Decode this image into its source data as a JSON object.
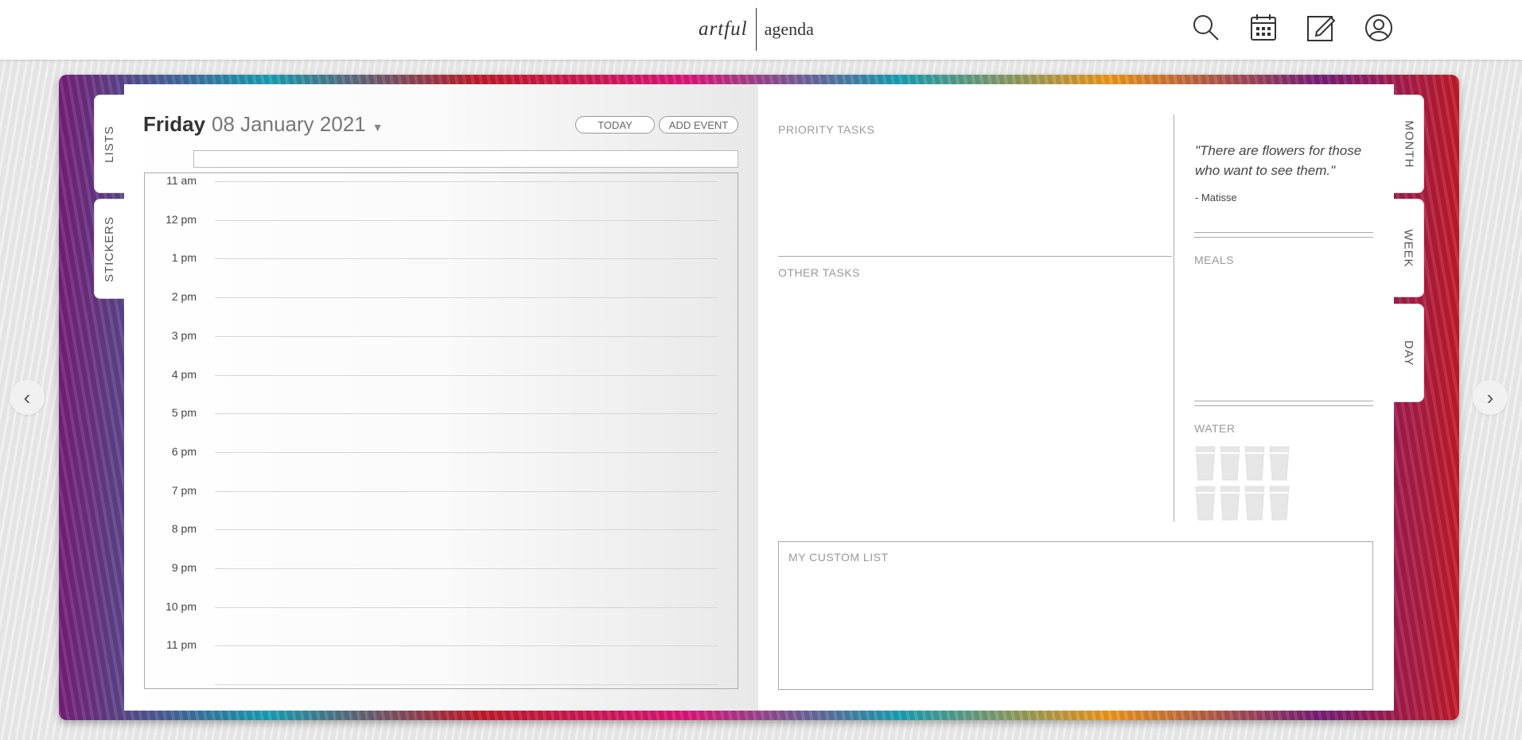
{
  "header": {
    "logo_part1": "artful",
    "logo_part2": "agenda",
    "icons": [
      "search-icon",
      "calendar-icon",
      "edit-icon",
      "user-icon"
    ]
  },
  "left_tabs": [
    "LISTS",
    "STICKERS"
  ],
  "right_tabs": [
    "MONTH",
    "WEEK",
    "DAY"
  ],
  "day": {
    "weekday": "Friday",
    "date": "08 January 2021",
    "today_label": "TODAY",
    "add_event_label": "ADD EVENT",
    "hours": [
      "11 am",
      "12 pm",
      "1 pm",
      "2 pm",
      "3 pm",
      "4 pm",
      "5 pm",
      "6 pm",
      "7 pm",
      "8 pm",
      "9 pm",
      "10 pm",
      "11 pm"
    ]
  },
  "right": {
    "priority_tasks": "PRIORITY TASKS",
    "other_tasks": "OTHER TASKS",
    "quote": "\"There are flowers for those who want to see them.\"",
    "quote_author": "- Matisse",
    "meals": "MEALS",
    "water": "WATER",
    "water_glasses": 8,
    "custom_list": "MY CUSTOM LIST"
  },
  "colors": {
    "text": "#333333",
    "muted": "#999999",
    "line": "#aaaaaa"
  }
}
